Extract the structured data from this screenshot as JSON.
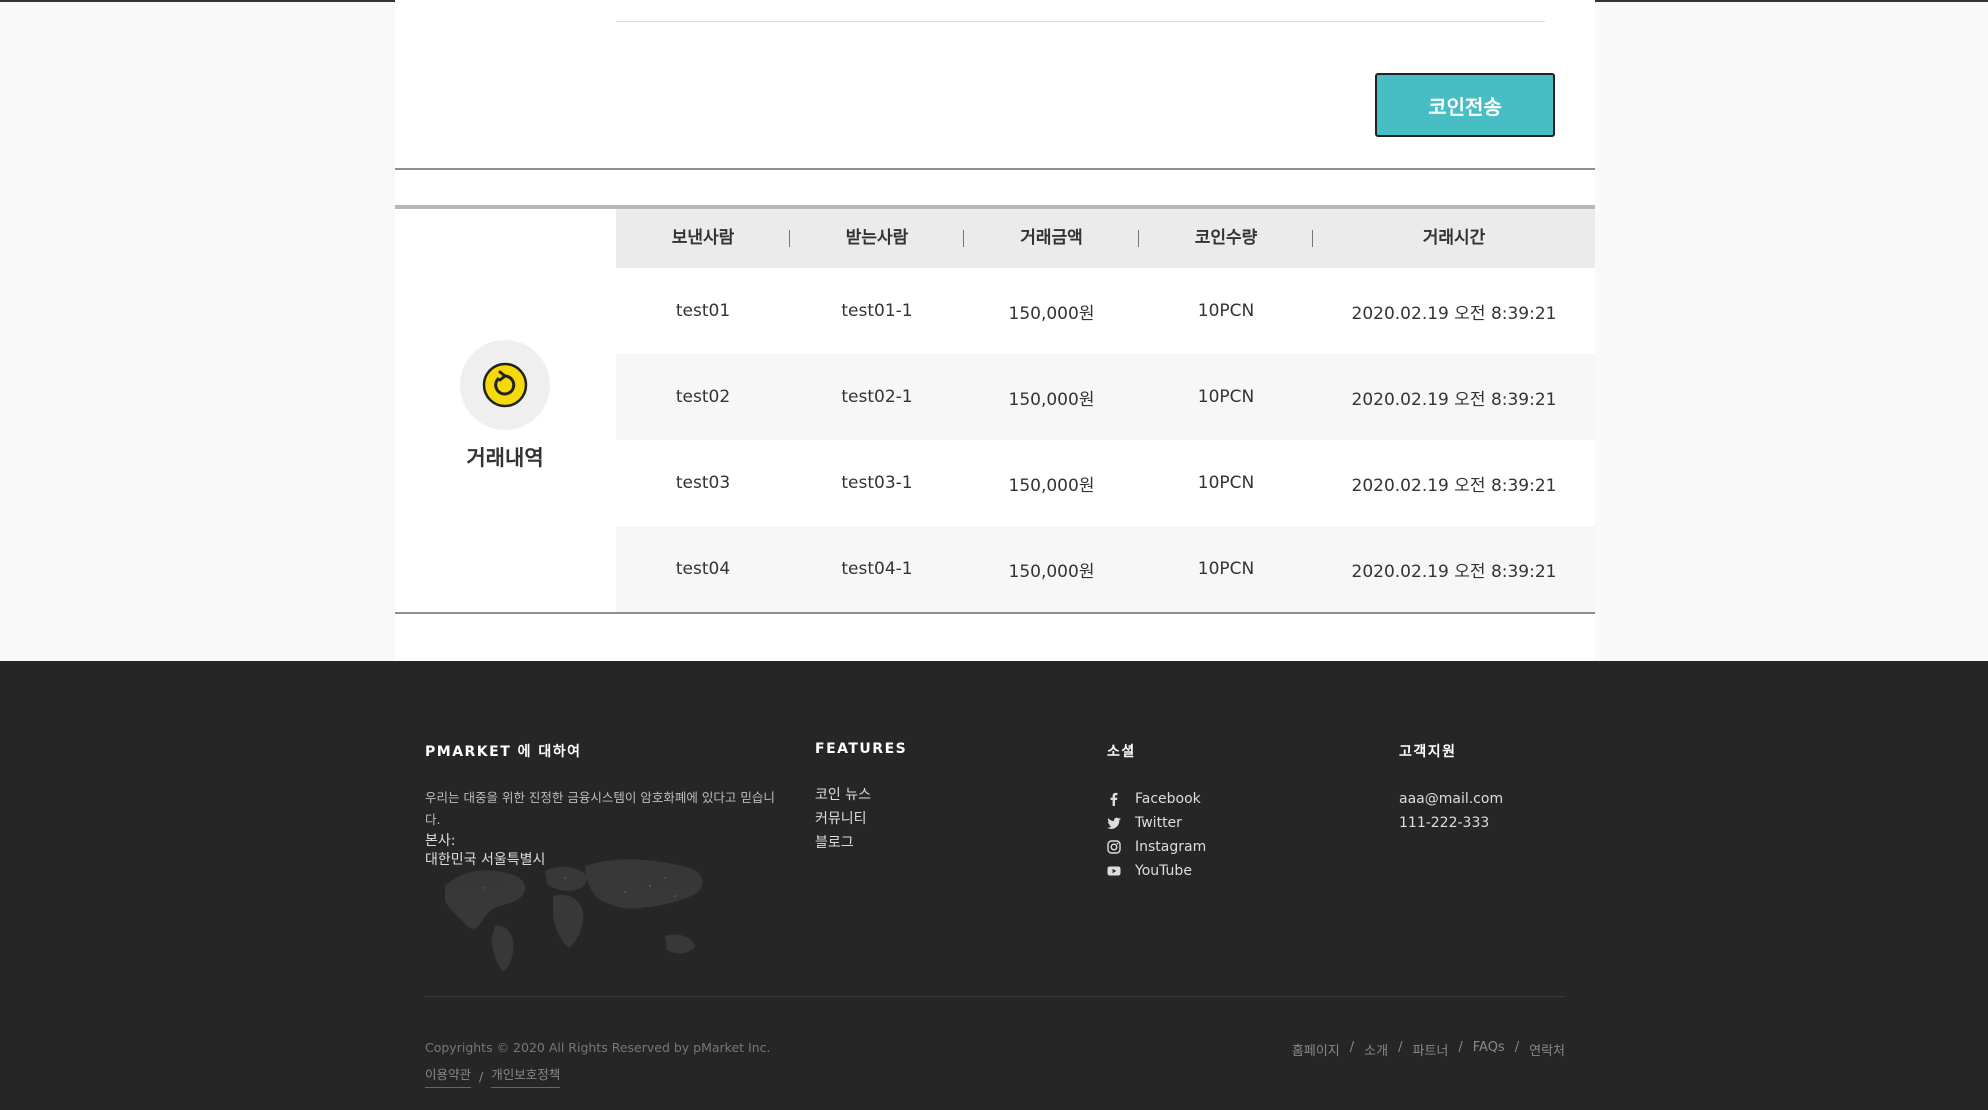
{
  "send": {
    "button_label": "코인전송"
  },
  "history": {
    "title": "거래내역",
    "columns": [
      "보낸사람",
      "받는사람",
      "거래금액",
      "코인수량",
      "거래시간"
    ],
    "rows": [
      [
        "test01",
        "test01-1",
        "150,000원",
        "10PCN",
        "2020.02.19 오전 8:39:21"
      ],
      [
        "test02",
        "test02-1",
        "150,000원",
        "10PCN",
        "2020.02.19 오전 8:39:21"
      ],
      [
        "test03",
        "test03-1",
        "150,000원",
        "10PCN",
        "2020.02.19 오전 8:39:21"
      ],
      [
        "test04",
        "test04-1",
        "150,000원",
        "10PCN",
        "2020.02.19 오전 8:39:21"
      ]
    ]
  },
  "footer": {
    "about": {
      "heading": "PMARKET 에 대하여",
      "text": "우리는 대중을 위한 진정한 금융시스템이 암호화폐에 있다고 믿습니다.",
      "hq_label": "본사:",
      "hq_value": "대한민국 서울특별시"
    },
    "features": {
      "heading": "FEATURES",
      "links": [
        "코인 뉴스",
        "커뮤니티",
        "블로그"
      ]
    },
    "social": {
      "heading": "소셜",
      "links": [
        {
          "label": "Facebook",
          "icon": "facebook-icon"
        },
        {
          "label": "Twitter",
          "icon": "twitter-icon"
        },
        {
          "label": "Instagram",
          "icon": "instagram-icon"
        },
        {
          "label": "YouTube",
          "icon": "youtube-icon"
        }
      ]
    },
    "support": {
      "heading": "고객지원",
      "email": "aaa@mail.com",
      "phone": "111-222-333"
    },
    "copyright": "Copyrights © 2020 All Rights Reserved by pMarket Inc.",
    "legal": [
      "이용약관",
      "개인보호정책"
    ],
    "nav": [
      "홈페이지",
      "소개",
      "파트너",
      "FAQs",
      "연락처"
    ]
  },
  "colors": {
    "accent": "#46bec3",
    "icon_yellow": "#f5d90a",
    "footer_bg": "#262626"
  }
}
